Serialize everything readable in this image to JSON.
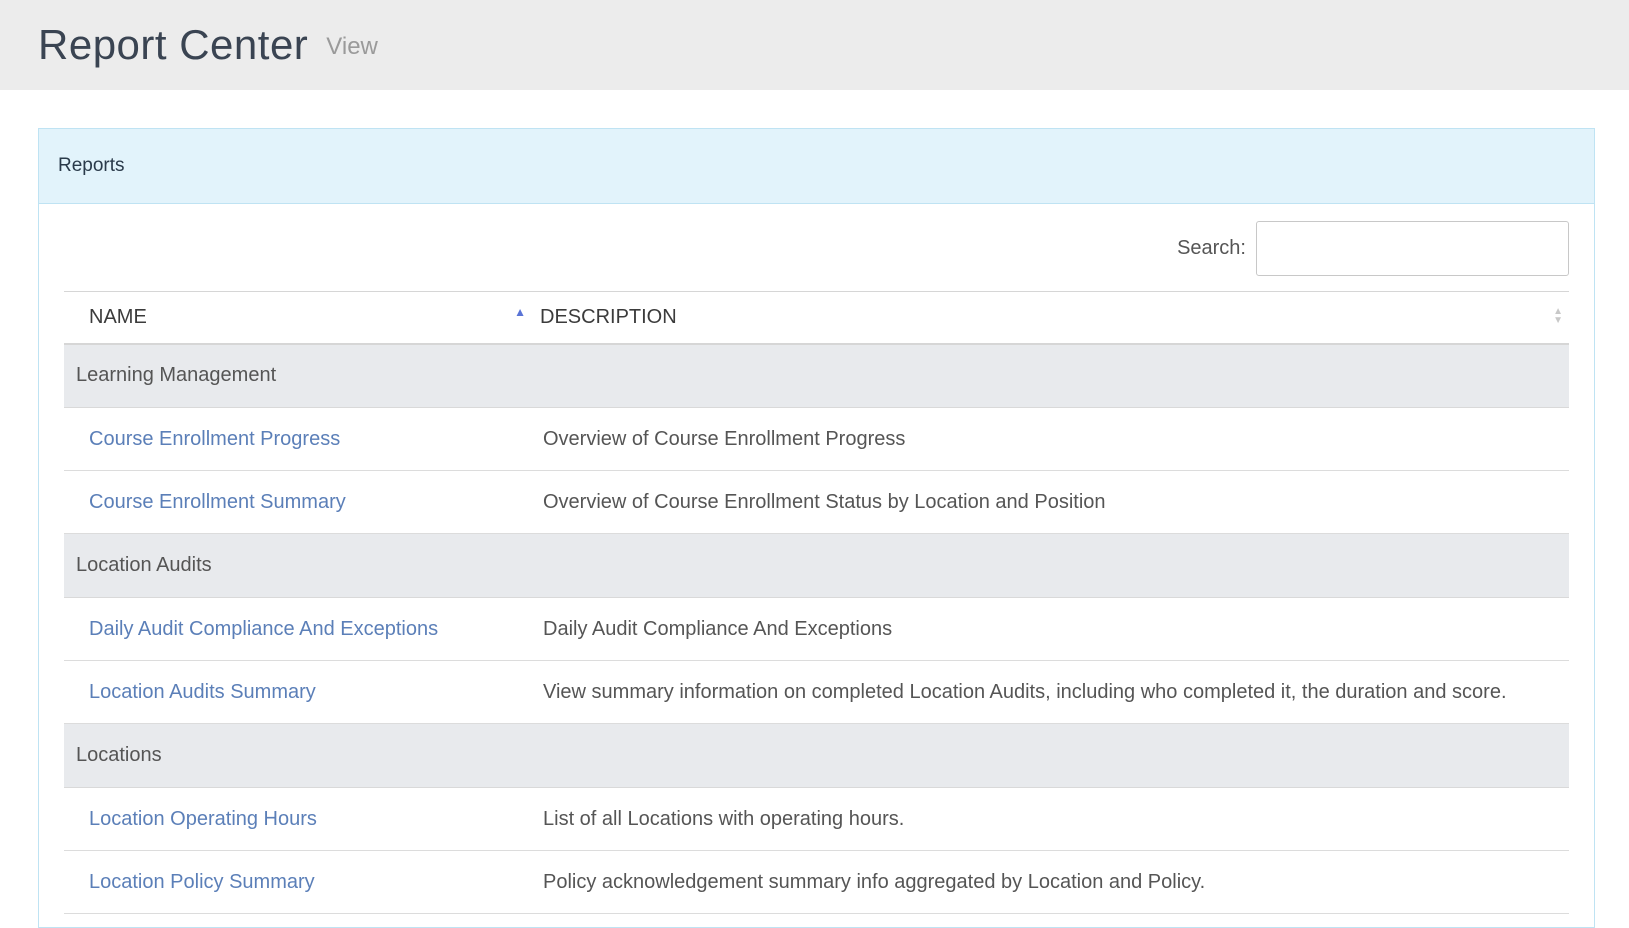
{
  "header": {
    "title": "Report Center",
    "subtitle": "View"
  },
  "panel": {
    "heading": "Reports"
  },
  "search": {
    "label": "Search:",
    "value": "",
    "placeholder": ""
  },
  "table": {
    "columns": {
      "name": "NAME",
      "description": "DESCRIPTION"
    },
    "groups": [
      {
        "label": "Learning Management",
        "rows": [
          {
            "name": "Course Enrollment Progress",
            "description": "Overview of Course Enrollment Progress"
          },
          {
            "name": "Course Enrollment Summary",
            "description": "Overview of Course Enrollment Status by Location and Position"
          }
        ]
      },
      {
        "label": "Location Audits",
        "rows": [
          {
            "name": "Daily Audit Compliance And Exceptions",
            "description": "Daily Audit Compliance And Exceptions"
          },
          {
            "name": "Location Audits Summary",
            "description": "View summary information on completed Location Audits, including who completed it, the duration and score."
          }
        ]
      },
      {
        "label": "Locations",
        "rows": [
          {
            "name": "Location Operating Hours",
            "description": "List of all Locations with operating hours."
          },
          {
            "name": "Location Policy Summary",
            "description": "Policy acknowledgement summary info aggregated by Location and Policy."
          }
        ]
      }
    ]
  },
  "icons": {
    "name_sort": "sort-ascending-icon",
    "description_sort": "sort-both-icon"
  },
  "colors": {
    "header_bg": "#ececec",
    "panel_heading_bg": "#e2f3fb",
    "group_row_bg": "#e8eaed",
    "link": "#5b7fb8",
    "sort_active": "#5a74d6"
  }
}
